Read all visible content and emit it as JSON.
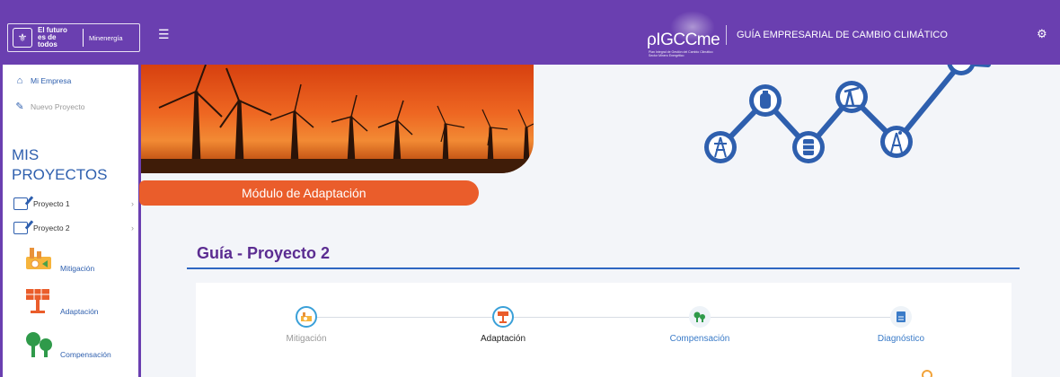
{
  "header": {
    "logo_line1": "El futuro",
    "logo_line2": "es de todos",
    "logo_ministry": "Minenergía",
    "brand_name": "ρIGCCme",
    "brand_sub": "Plan Integral de Gestión del Cambio Climático Sector Minero Energético",
    "title": "GUÍA EMPRESARIAL DE CAMBIO CLIMÁTICO"
  },
  "sidebar": {
    "mi_empresa": "Mi Empresa",
    "nuevo_proyecto": "Nuevo Proyecto",
    "mis_proyectos_line1": "MIS",
    "mis_proyectos_line2": "PROYECTOS",
    "projects": [
      "Proyecto 1",
      "Proyecto 2"
    ],
    "modules": [
      "Mitigación",
      "Adaptación",
      "Compensación"
    ]
  },
  "banner": {
    "label": "Módulo de Adaptación"
  },
  "main": {
    "title": "Guía - Proyecto 2",
    "steps": [
      {
        "label": "Mitigación",
        "icon": "factory-icon"
      },
      {
        "label": "Adaptación",
        "icon": "solar-panel-icon"
      },
      {
        "label": "Compensación",
        "icon": "trees-icon"
      },
      {
        "label": "Diagnóstico",
        "icon": "document-icon"
      }
    ]
  },
  "colors": {
    "header_bg": "#6a3fb0",
    "accent_blue": "#2e5fae",
    "banner_orange": "#ea5d2b",
    "title_purple": "#5b2c91"
  }
}
